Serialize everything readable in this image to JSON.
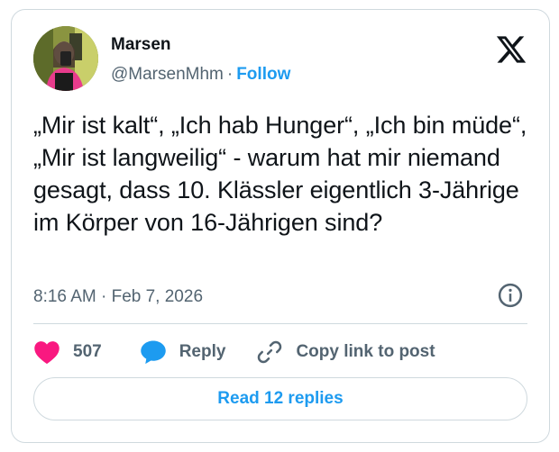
{
  "author": {
    "name": "Marsen",
    "handle": "@MarsenMhm",
    "separator": "·",
    "follow_label": "Follow"
  },
  "tweet": {
    "text": "„Mir ist kalt“, „Ich hab Hunger“, „Ich bin müde“, „Mir ist langweilig“ - warum hat mir niemand gesagt, dass 10. Klässler eigentlich 3-Jährige im Körper von 16-Jährigen sind?",
    "timestamp": "8:16 AM · Feb 7, 2026"
  },
  "actions": {
    "like_count": "507",
    "reply_label": "Reply",
    "copy_link_label": "Copy link to post"
  },
  "footer": {
    "read_replies_label": "Read 12 replies"
  },
  "colors": {
    "accent": "#1d9bf0",
    "like": "#f91880",
    "muted_text": "#536471",
    "border": "#cfd9de"
  },
  "icons": {
    "logo": "x-logo-icon",
    "info": "info-icon",
    "like": "heart-icon",
    "reply": "speech-bubble-icon",
    "copy": "link-icon"
  }
}
